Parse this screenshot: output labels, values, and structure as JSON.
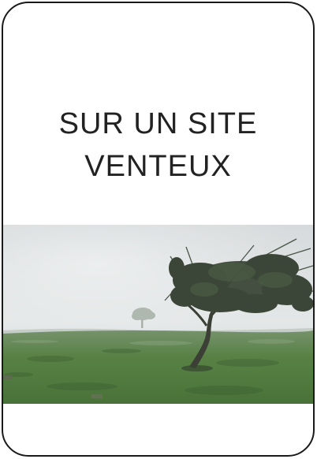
{
  "card": {
    "title_line1": "SUR UN SITE",
    "title_line2": "VENTEUX",
    "photo": {
      "subject": "windswept-tree-in-fog",
      "colors": {
        "sky_top": "#d4d8da",
        "sky_mid": "#e3e6e6",
        "horizon": "#c9cfcc",
        "grass_near": "#3e6a2c",
        "grass_far": "#6d8c63",
        "tree": "#2f3b2c"
      }
    }
  }
}
